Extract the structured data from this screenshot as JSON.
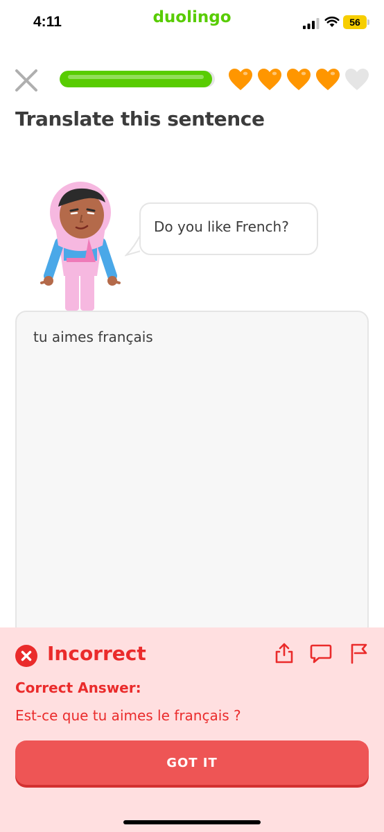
{
  "status_bar": {
    "time": "4:11",
    "app_name": "duolingo",
    "battery": "56",
    "icons": [
      "signal-icon",
      "wifi-icon",
      "battery-icon"
    ]
  },
  "header": {
    "close_icon": "close-icon",
    "progress_fraction": 0.98,
    "hearts_filled": 4,
    "hearts_total": 5,
    "heart_color": "#ff9600",
    "heart_empty_color": "#e5e5e5"
  },
  "exercise": {
    "title": "Translate this sentence",
    "prompt": "Do you like French?",
    "answer": "tu aimes français"
  },
  "feedback": {
    "title": "Incorrect",
    "correct_label": "Correct Answer:",
    "correct_answer": "Est-ce que tu aimes le français ?",
    "button_label": "GOT IT",
    "icons": [
      "incorrect-icon",
      "share-icon",
      "comment-icon",
      "flag-icon"
    ],
    "colors": {
      "panel": "#ffdfe0",
      "accent": "#ea2b2b",
      "button": "#ee5555"
    }
  },
  "colors": {
    "brand": "#58cc02",
    "progress": "#58cc02"
  }
}
